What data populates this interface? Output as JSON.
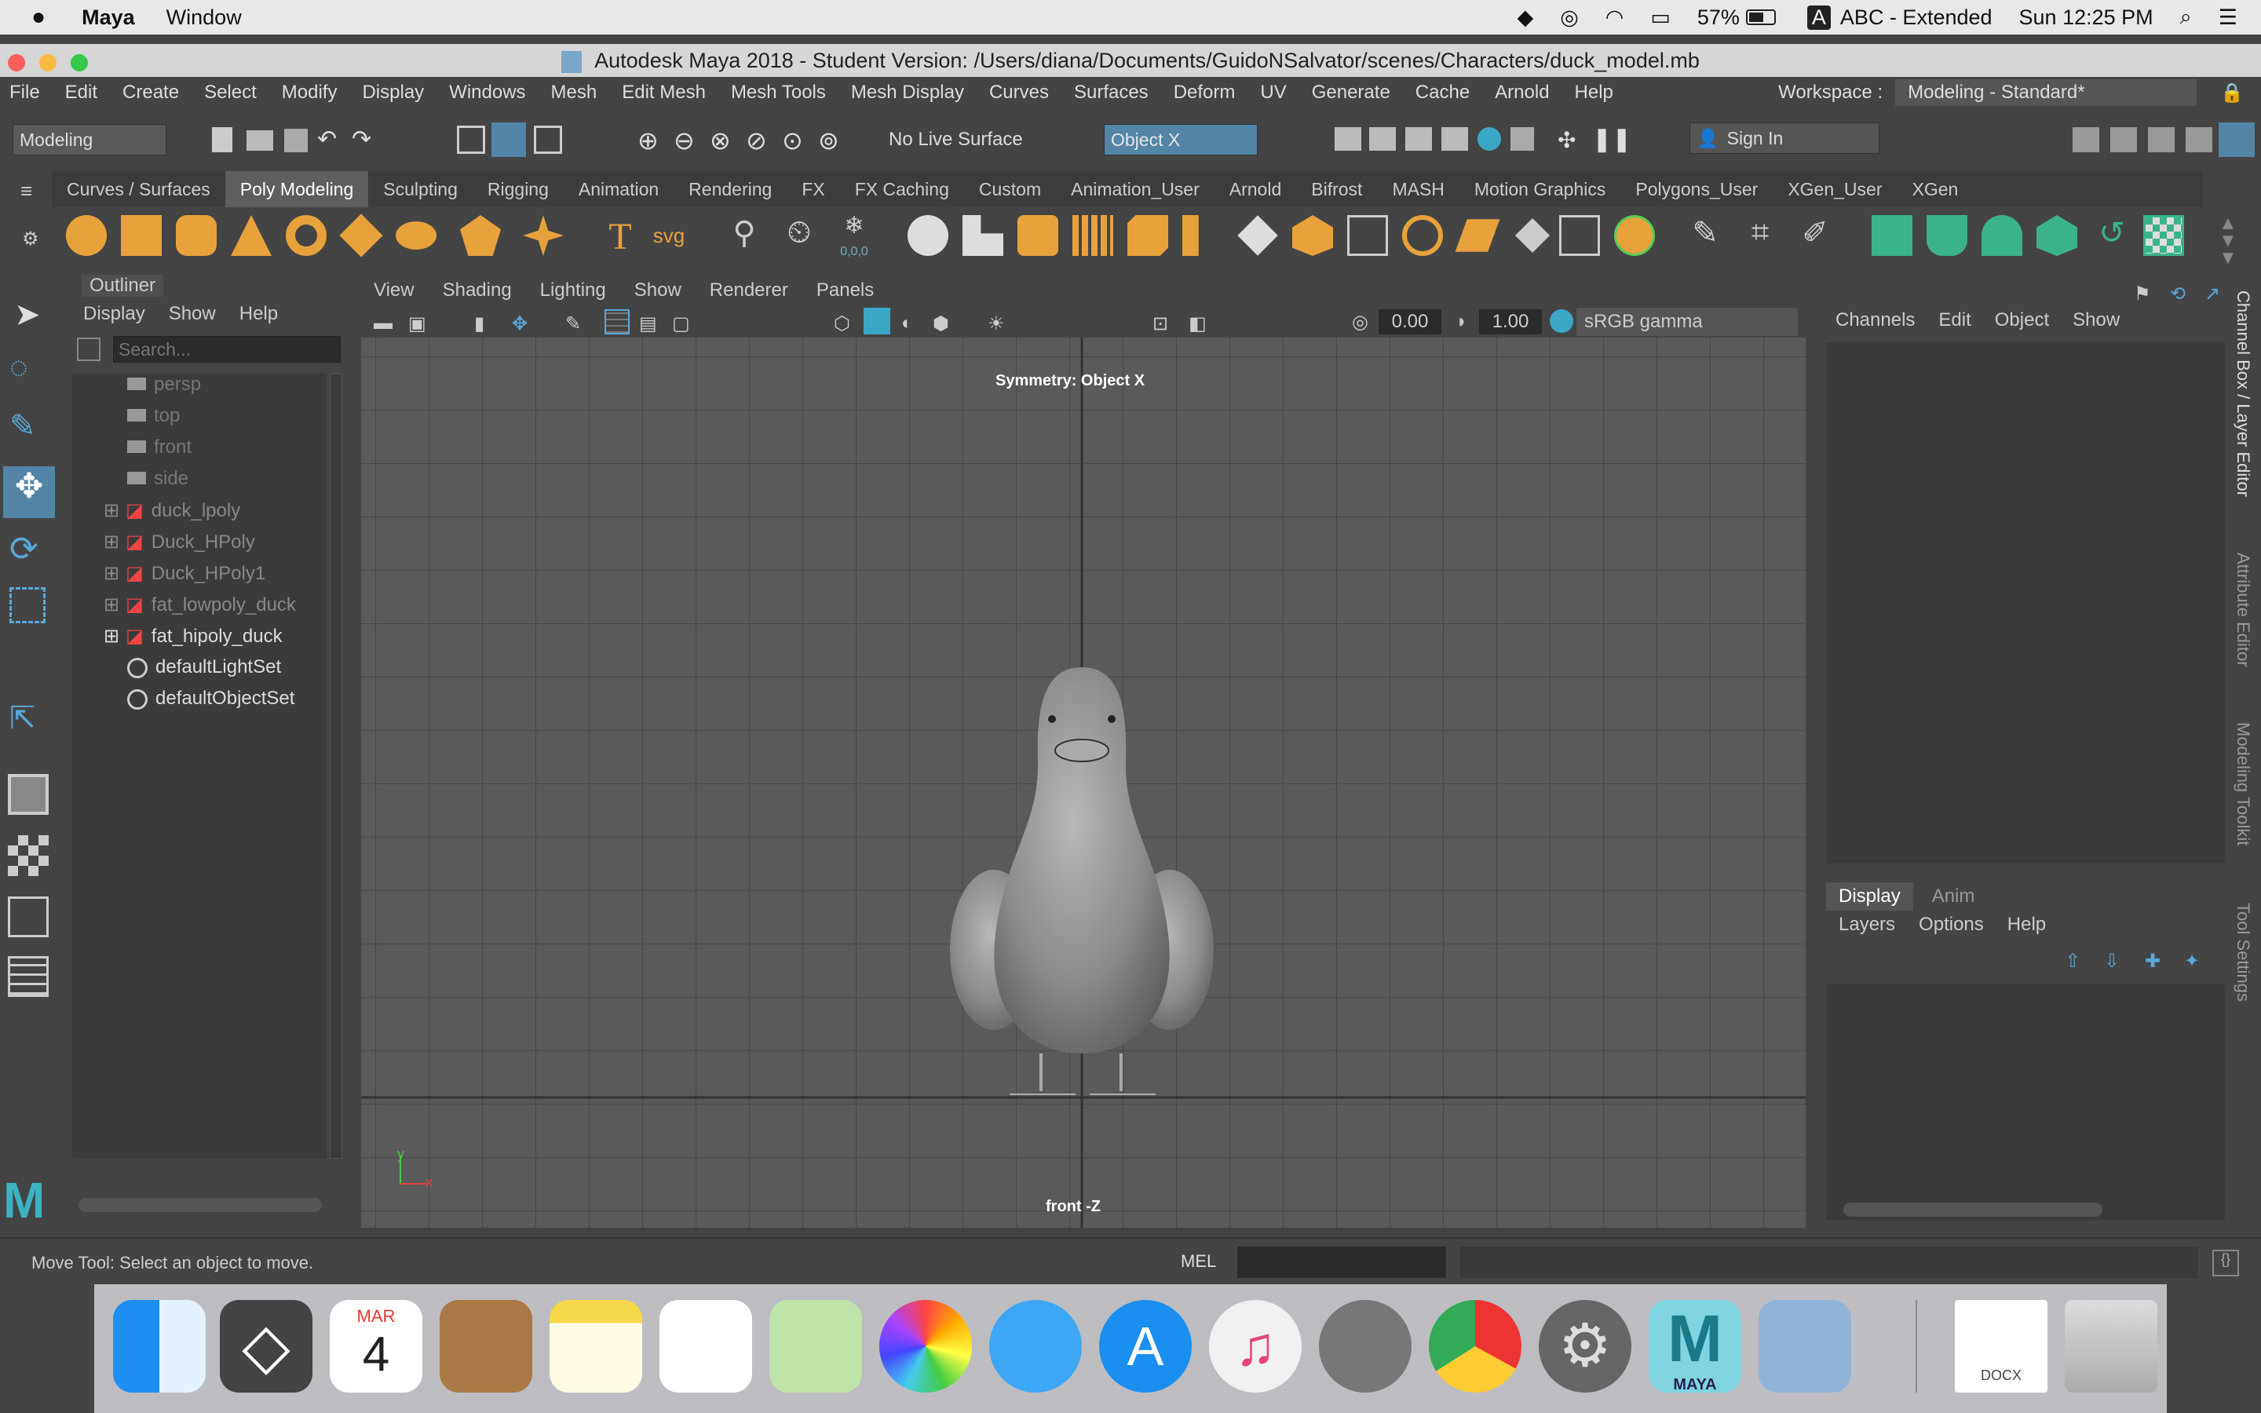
{
  "mac_menubar": {
    "app": "Maya",
    "items": [
      "Window"
    ],
    "battery": "57%",
    "input_source": "ABC - Extended",
    "clock": "Sun 12:25 PM"
  },
  "window_title": "Autodesk Maya 2018 - Student Version: /Users/diana/Documents/GuidoNSalvator/scenes/Characters/duck_model.mb",
  "main_menu": [
    "File",
    "Edit",
    "Create",
    "Select",
    "Modify",
    "Display",
    "Windows",
    "Mesh",
    "Edit Mesh",
    "Mesh Tools",
    "Mesh Display",
    "Curves",
    "Surfaces",
    "Deform",
    "UV",
    "Generate",
    "Cache",
    "Arnold",
    "Help"
  ],
  "workspace": {
    "label": "Workspace :",
    "value": "Modeling - Standard*"
  },
  "toolbar": {
    "mode": "Modeling",
    "live_surface": "No Live Surface",
    "symmetry": "Object X",
    "sign_in": "Sign In"
  },
  "shelf_tabs": [
    "Curves / Surfaces",
    "Poly Modeling",
    "Sculpting",
    "Rigging",
    "Animation",
    "Rendering",
    "FX",
    "FX Caching",
    "Custom",
    "Animation_User",
    "Arnold",
    "Bifrost",
    "MASH",
    "Motion Graphics",
    "Polygons_User",
    "XGen_User",
    "XGen"
  ],
  "shelf_active": "Poly Modeling",
  "shelf_texts": {
    "text_tool": "T",
    "svg_tool": "svg",
    "coords": "0,0,0"
  },
  "outliner": {
    "title": "Outliner",
    "menu": [
      "Display",
      "Show",
      "Help"
    ],
    "search_placeholder": "Search...",
    "items": [
      {
        "name": "persp",
        "type": "camera",
        "dim": true
      },
      {
        "name": "top",
        "type": "camera",
        "dim": true
      },
      {
        "name": "front",
        "type": "camera",
        "dim": true
      },
      {
        "name": "side",
        "type": "camera",
        "dim": true
      },
      {
        "name": "duck_lpoly",
        "type": "mesh",
        "dim": true
      },
      {
        "name": "Duck_HPoly",
        "type": "mesh",
        "dim": true
      },
      {
        "name": "Duck_HPoly1",
        "type": "mesh",
        "dim": true
      },
      {
        "name": "fat_lowpoly_duck",
        "type": "mesh",
        "dim": true
      },
      {
        "name": "fat_hipoly_duck",
        "type": "mesh",
        "dim": false
      },
      {
        "name": "defaultLightSet",
        "type": "set",
        "dim": false
      },
      {
        "name": "defaultObjectSet",
        "type": "set",
        "dim": false
      }
    ]
  },
  "viewport": {
    "menu": [
      "View",
      "Shading",
      "Lighting",
      "Show",
      "Renderer",
      "Panels"
    ],
    "exposure": "0.00",
    "gamma": "1.00",
    "color_space": "sRGB gamma",
    "symmetry_label": "Symmetry: Object X",
    "camera_label": "front -Z",
    "axis_y": "y",
    "axis_x": "x"
  },
  "channel_box": {
    "menu": [
      "Channels",
      "Edit",
      "Object",
      "Show"
    ]
  },
  "layer_editor": {
    "tabs": [
      "Display",
      "Anim"
    ],
    "menu": [
      "Layers",
      "Options",
      "Help"
    ]
  },
  "side_tabs": [
    "Channel Box / Layer Editor",
    "Attribute Editor",
    "Modeling Toolkit",
    "Tool Settings"
  ],
  "status": {
    "help_line": "Move Tool: Select an object to move.",
    "command_lang": "MEL"
  },
  "dock": {
    "calendar_month": "MAR",
    "calendar_day": "4",
    "maya_label": "MAYA",
    "doc_label": "DOCX"
  },
  "colors": {
    "accent": "#5285a6",
    "shelf_orange": "#e8a23c",
    "ui_bg": "#444444",
    "viewport_bg": "#5a5a5a"
  }
}
